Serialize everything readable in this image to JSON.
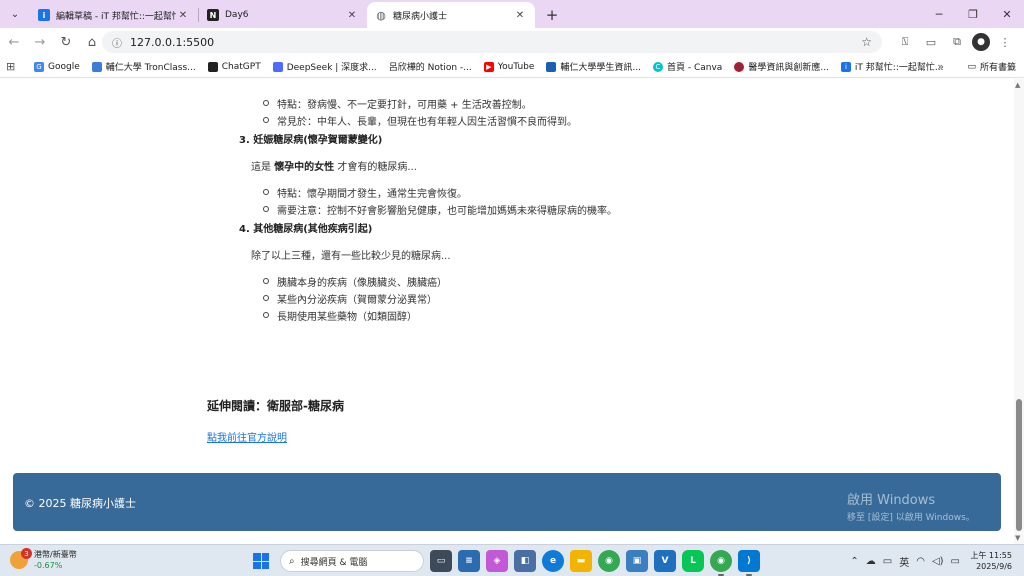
{
  "browser": {
    "tabs": [
      {
        "label": "編輯草稿 - iT 邦幫忙::一起幫忙解決難題",
        "favicon": "it-icon",
        "color": "#1a73e8"
      },
      {
        "label": "Day6",
        "favicon": "notion-icon",
        "color": "#222222"
      },
      {
        "label": "糖尿病小護士",
        "favicon": "globe-icon",
        "color": "#5f6368"
      }
    ],
    "url": "127.0.0.1:5500",
    "bookmarks": [
      {
        "label": "Google",
        "color": "#4285f4"
      },
      {
        "label": "輔仁大學 TronClass...",
        "color": "#3b7dd8"
      },
      {
        "label": "ChatGPT",
        "color": "#222222"
      },
      {
        "label": "DeepSeek | 深度求...",
        "color": "#4d6bfe"
      },
      {
        "label": "呂欣樺的 Notion -...",
        "color": "#ffffff"
      },
      {
        "label": "YouTube",
        "color": "#ff0000"
      },
      {
        "label": "輔仁大學學生資訊...",
        "color": "#1a5fb4"
      },
      {
        "label": "首頁 - Canva",
        "color": "#00c4cc"
      },
      {
        "label": "醫學資訊與創新應...",
        "color": "#a31f34"
      },
      {
        "label": "iT 邦幫忙::一起幫忙...",
        "color": "#1a73e8"
      }
    ],
    "all_bookmarks": "所有書籤"
  },
  "content": {
    "type2_items": [
      "特點：發病慢、不一定要打針，可用藥 + 生活改善控制。",
      "常見於：中年人、長輩，但現在也有年輕人因生活習慣不良而得到。"
    ],
    "type3_heading": "3. 妊娠糖尿病(懷孕賀爾蒙變化)",
    "type3_para_pre": "這是 ",
    "type3_para_bold": "懷孕中的女性",
    "type3_para_post": " 才會有的糖尿病...",
    "type3_items": [
      "特點：懷孕期間才發生，通常生完會恢復。",
      "需要注意：控制不好會影響胎兒健康，也可能增加媽媽未來得糖尿病的機率。"
    ],
    "type4_heading": "4. 其他糖尿病(其他疾病引起)",
    "type4_para": "除了以上三種，還有一些比較少見的糖尿病...",
    "type4_items": [
      "胰臟本身的疾病（像胰臟炎、胰臟癌）",
      "某些內分泌疾病（賀爾蒙分泌異常）",
      "長期使用某些藥物（如類固醇）"
    ],
    "more_title": "延伸閱讀：衛服部-糖尿病",
    "more_link": "點我前往官方說明",
    "footer": "© 2025 糖尿病小護士",
    "activate_title": "啟用 Windows",
    "activate_sub": "移至 [設定] 以啟用 Windows。"
  },
  "taskbar": {
    "weather_badge": "3",
    "weather_label": "港幣/新臺幣",
    "weather_value": "-0.67%",
    "search_placeholder": "搜尋網頁 & 電腦",
    "ime": "英",
    "time": "上午 11:55",
    "date": "2025/9/6"
  }
}
